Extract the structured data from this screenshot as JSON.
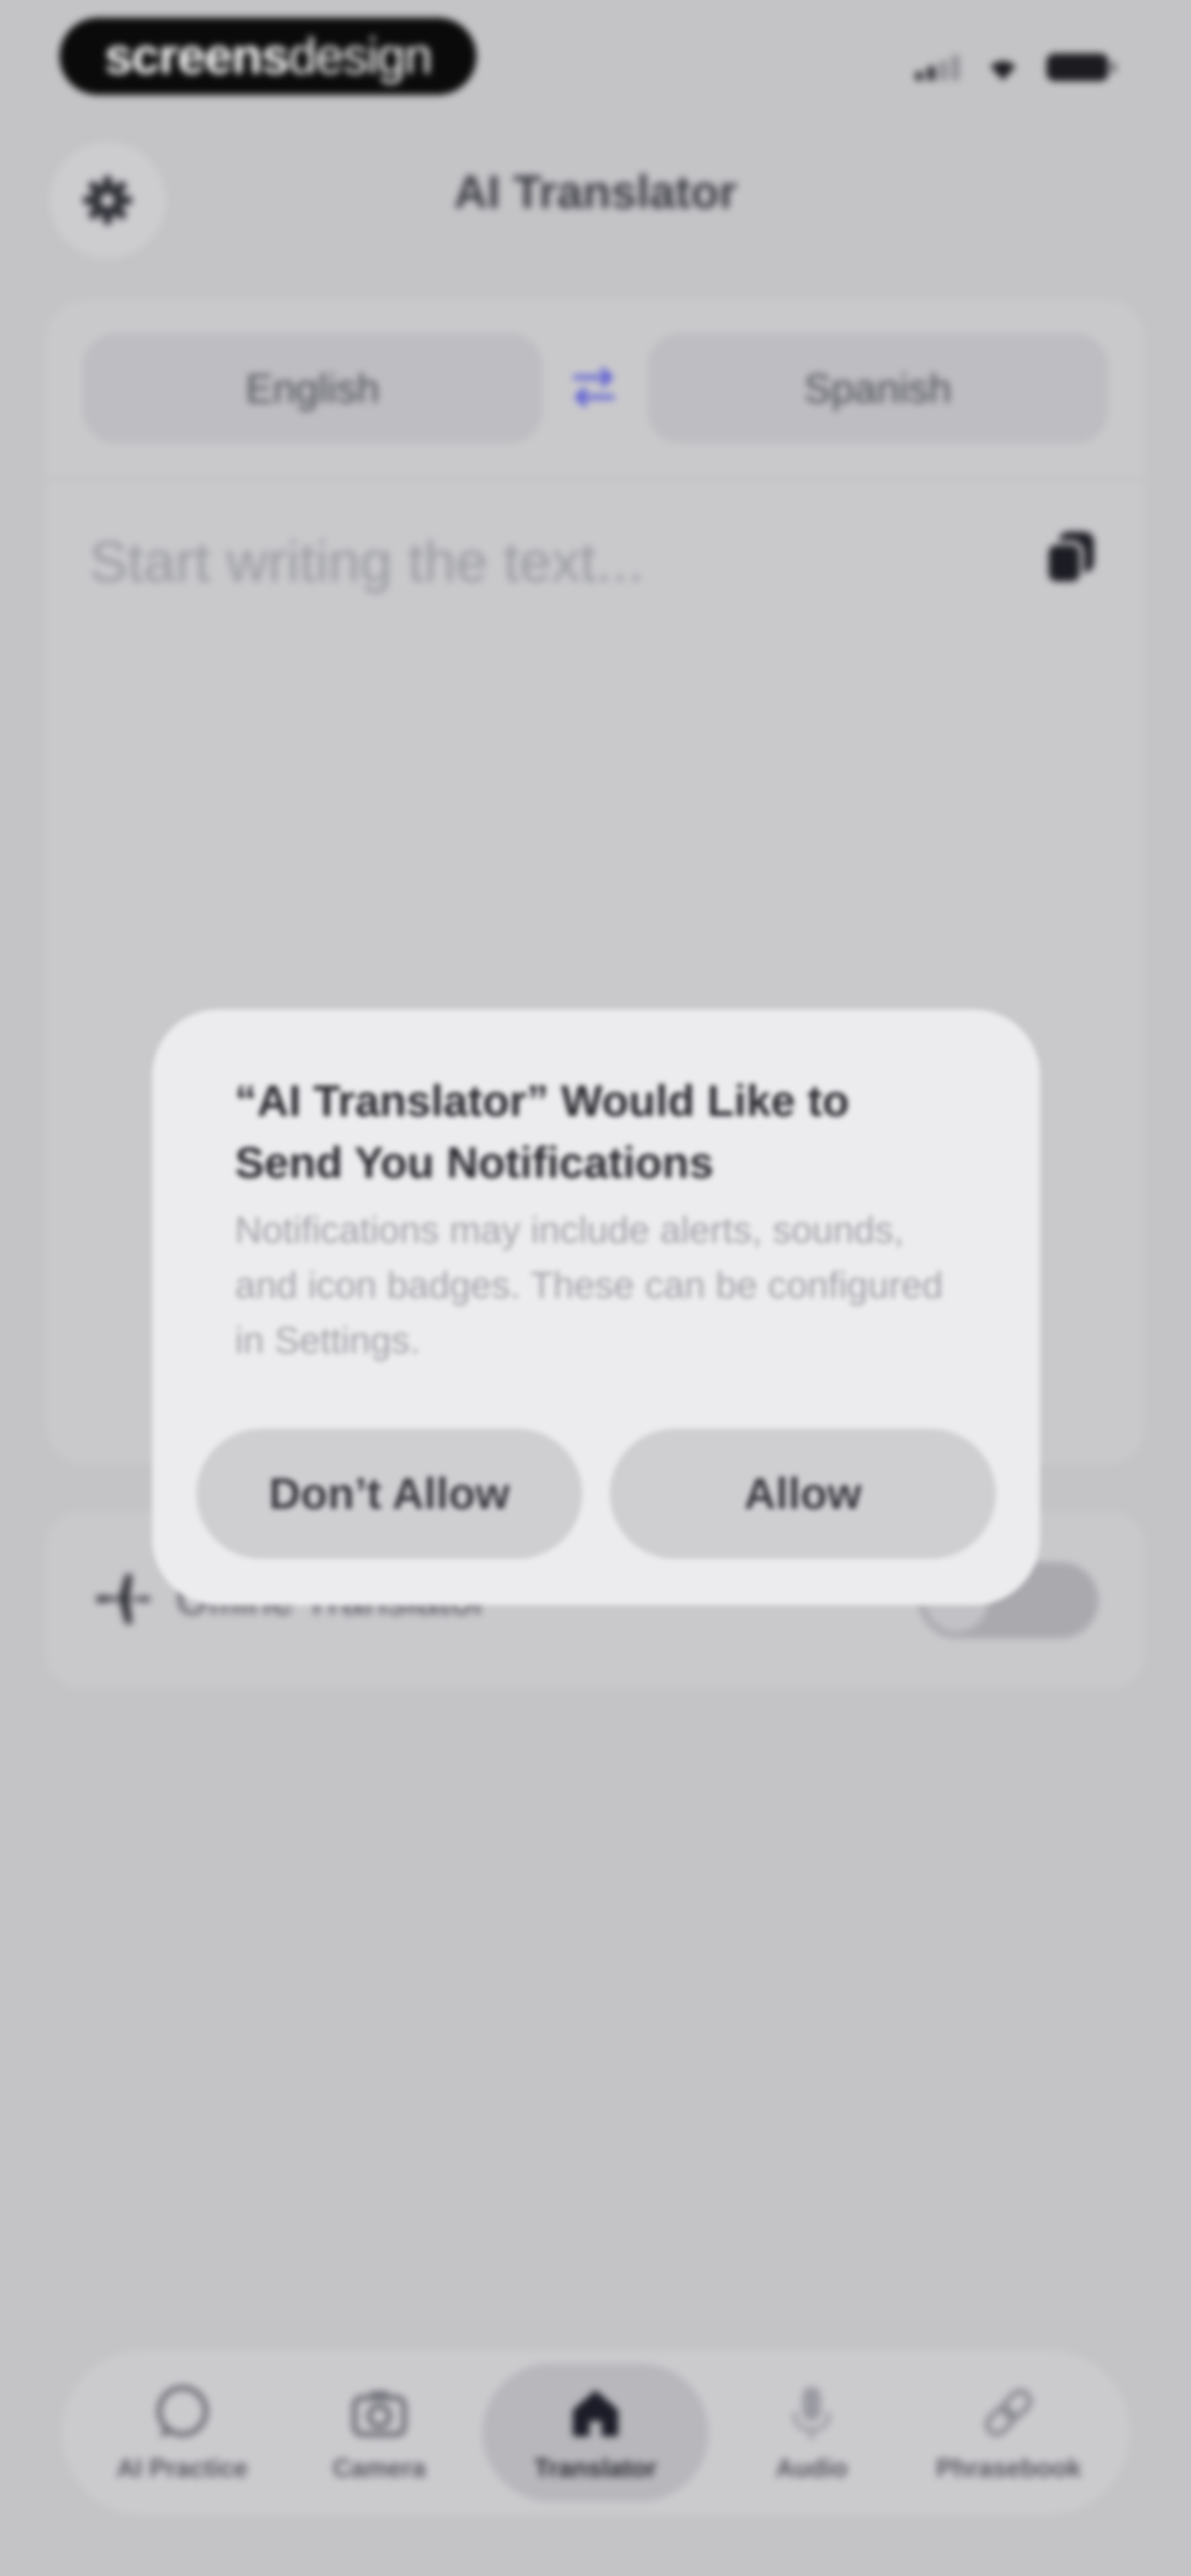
{
  "status_bar": {
    "watermark_bold": "screens",
    "watermark_light": "design"
  },
  "header": {
    "title": "AI Translator",
    "settings_icon": "gear-icon"
  },
  "translator": {
    "source_language": "English",
    "target_language": "Spanish",
    "swap_icon": "swap-arrows-icon",
    "input_placeholder": "Start writing the text...",
    "paste_icon": "paste-icon"
  },
  "offline": {
    "label": "Offline Translator",
    "enabled": false
  },
  "tabs": [
    {
      "label": "AI Practice",
      "icon": "chat-bubble-icon",
      "active": false
    },
    {
      "label": "Camera",
      "icon": "camera-icon",
      "active": false
    },
    {
      "label": "Translator",
      "icon": "home-icon",
      "active": true
    },
    {
      "label": "Audio",
      "icon": "microphone-icon",
      "active": false
    },
    {
      "label": "Phrasebook",
      "icon": "link-icon",
      "active": false
    }
  ],
  "alert": {
    "title": "“AI Translator” Would Like to Send You Notifications",
    "message": "Notifications may include alerts, sounds, and icon badges. These can be configured in Settings.",
    "deny_label": "Don’t Allow",
    "allow_label": "Allow"
  },
  "colors": {
    "background": "#c4c4c7",
    "alert_background": "#ececee",
    "accent": "#5a5ad6"
  }
}
